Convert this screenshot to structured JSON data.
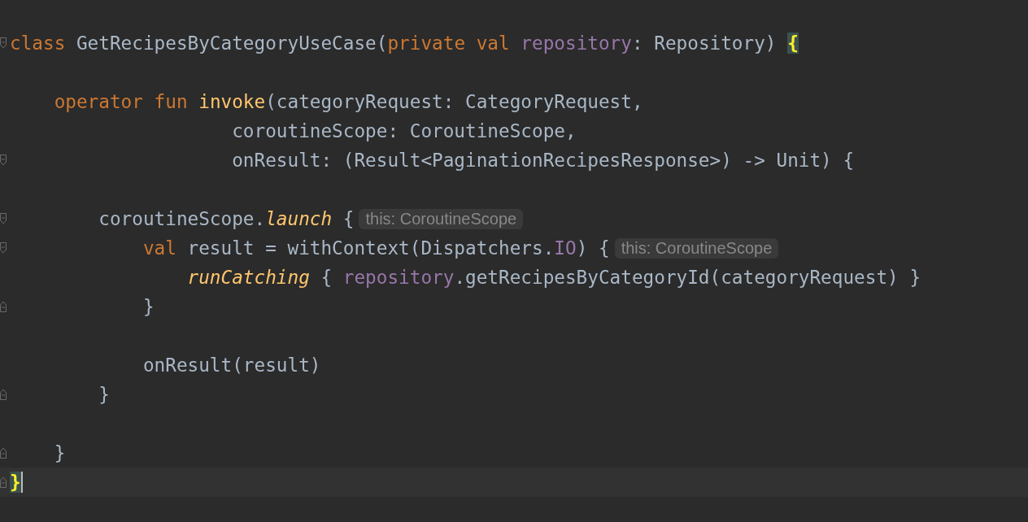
{
  "editor": {
    "lines": [
      {
        "fold_start": true,
        "fold_end": false,
        "current": false,
        "tokens": [
          {
            "kind": "keyword",
            "text": "class"
          },
          {
            "kind": "plain",
            "text": " GetRecipesByCategoryUseCase("
          },
          {
            "kind": "keyword",
            "text": "private val "
          },
          {
            "kind": "property",
            "text": "repository"
          },
          {
            "kind": "plain",
            "text": ": Repository) "
          },
          {
            "kind": "match",
            "text": "{"
          }
        ]
      },
      {
        "fold_start": false,
        "fold_end": false,
        "current": false
      },
      {
        "fold_start": false,
        "fold_end": false,
        "current": false,
        "tokens": [
          {
            "kind": "keyword",
            "text": "    operator fun "
          },
          {
            "kind": "function",
            "text": "invoke"
          },
          {
            "kind": "plain",
            "text": "(categoryRequest: CategoryRequest,"
          }
        ]
      },
      {
        "fold_start": false,
        "fold_end": false,
        "current": false,
        "tokens": [
          {
            "kind": "plain",
            "text": "                    coroutineScope: CoroutineScope,"
          }
        ]
      },
      {
        "fold_start": true,
        "fold_end": false,
        "current": false,
        "tokens": [
          {
            "kind": "plain",
            "text": "                    onResult: (Result<PaginationRecipesResponse>) -> Unit) {"
          }
        ]
      },
      {
        "fold_start": false,
        "fold_end": false,
        "current": false
      },
      {
        "fold_start": true,
        "fold_end": false,
        "current": false,
        "tokens": [
          {
            "kind": "plain",
            "text": "        coroutineScope."
          },
          {
            "kind": "call",
            "text": "launch"
          },
          {
            "kind": "plain",
            "text": " {"
          },
          {
            "kind": "hint",
            "text": "this: CoroutineScope"
          }
        ]
      },
      {
        "fold_start": true,
        "fold_end": false,
        "current": false,
        "tokens": [
          {
            "kind": "keyword",
            "text": "            val"
          },
          {
            "kind": "plain",
            "text": " result = withContext(Dispatchers."
          },
          {
            "kind": "property",
            "text": "IO"
          },
          {
            "kind": "plain",
            "text": ") {"
          },
          {
            "kind": "hint",
            "text": "this: CoroutineScope"
          }
        ]
      },
      {
        "fold_start": false,
        "fold_end": false,
        "current": false,
        "tokens": [
          {
            "kind": "call",
            "text": "                runCatching"
          },
          {
            "kind": "plain",
            "text": " { "
          },
          {
            "kind": "property",
            "text": "repository"
          },
          {
            "kind": "plain",
            "text": ".getRecipesByCategoryId(categoryRequest) }"
          }
        ]
      },
      {
        "fold_start": false,
        "fold_end": true,
        "current": false,
        "tokens": [
          {
            "kind": "plain",
            "text": "            }"
          }
        ]
      },
      {
        "fold_start": false,
        "fold_end": false,
        "current": false
      },
      {
        "fold_start": false,
        "fold_end": false,
        "current": false,
        "tokens": [
          {
            "kind": "plain",
            "text": "            onResult(result)"
          }
        ]
      },
      {
        "fold_start": false,
        "fold_end": true,
        "current": false,
        "tokens": [
          {
            "kind": "plain",
            "text": "        }"
          }
        ]
      },
      {
        "fold_start": false,
        "fold_end": false,
        "current": false
      },
      {
        "fold_start": false,
        "fold_end": true,
        "current": false,
        "tokens": [
          {
            "kind": "plain",
            "text": "    }"
          }
        ]
      },
      {
        "fold_start": false,
        "fold_end": true,
        "current": true,
        "tokens": [
          {
            "kind": "match",
            "text": "}"
          }
        ]
      }
    ]
  }
}
